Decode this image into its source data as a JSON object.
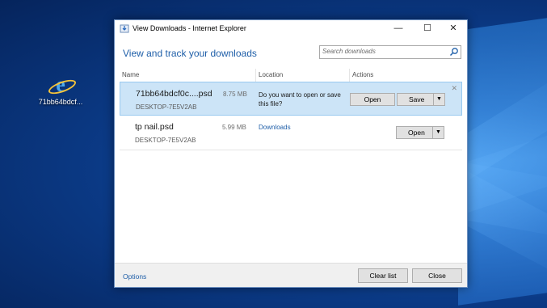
{
  "desktop": {
    "icon_label": "71bb64bdcf...",
    "icon_name": "internet-explorer-icon"
  },
  "window": {
    "title": "View Downloads - Internet Explorer",
    "heading": "View and track your downloads",
    "search_placeholder": "Search downloads",
    "controls": {
      "minimize": "—",
      "maximize": "☐",
      "close": "✕"
    }
  },
  "columns": {
    "name": "Name",
    "location": "Location",
    "actions": "Actions"
  },
  "downloads": [
    {
      "name": "71bb64bdcf0c....psd",
      "host": "DESKTOP-7E5V2AB",
      "size": "8.75 MB",
      "location_text": "Do you want to open or save this file?",
      "open_label": "Open",
      "save_label": "Save",
      "dismiss": "✕"
    },
    {
      "name": "tp nail.psd",
      "host": "DESKTOP-7E5V2AB",
      "size": "5.99 MB",
      "location_link": "Downloads",
      "open_label": "Open"
    }
  ],
  "footer": {
    "options_label": "Options",
    "clear_label": "Clear list",
    "close_label": "Close"
  },
  "colors": {
    "accent": "#1e5ea8",
    "selection": "#cce4f7",
    "button_face": "#e1e1e1"
  }
}
